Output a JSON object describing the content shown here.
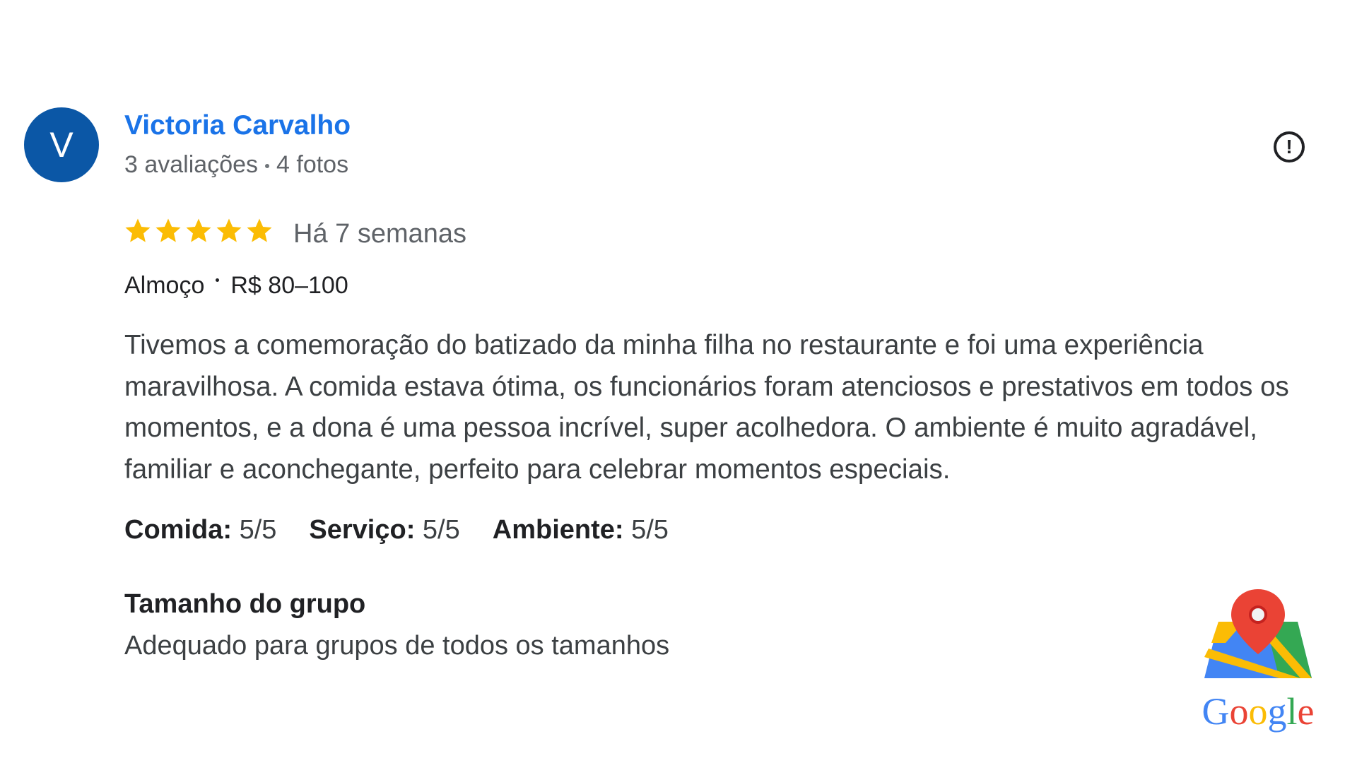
{
  "reviewer": {
    "initial": "V",
    "name": "Victoria Carvalho",
    "reviews_count": "3 avaliações",
    "photos_count": "4 fotos",
    "avatar_color": "#0b57a6"
  },
  "report_icon": "exclamation-circle-icon",
  "rating": {
    "stars": 5,
    "max_stars": 5,
    "star_color": "#fbbc04",
    "date": "Há 7 semanas"
  },
  "meal": {
    "type": "Almoço",
    "price": "R$ 80–100"
  },
  "review_text": "Tivemos a comemoração do batizado da minha filha no restaurante e foi uma experiência maravilhosa. A comida estava ótima, os funcionários foram atenciosos e prestativos em todos os momentos, e a dona é uma pessoa incrível, super acolhedora. O ambiente é muito agradável, familiar e aconchegante, perfeito para celebrar momentos especiais.",
  "sub_ratings": [
    {
      "label": "Comida:",
      "value": "5/5"
    },
    {
      "label": "Serviço:",
      "value": "5/5"
    },
    {
      "label": "Ambiente:",
      "value": "5/5"
    }
  ],
  "group": {
    "heading": "Tamanho do grupo",
    "value": "Adequado para grupos de todos os tamanhos"
  },
  "brand": {
    "wordmark": "Google",
    "icon": "google-maps-icon",
    "colors": {
      "blue": "#4285f4",
      "red": "#ea4335",
      "yellow": "#fbbc05",
      "green": "#34a853"
    }
  }
}
